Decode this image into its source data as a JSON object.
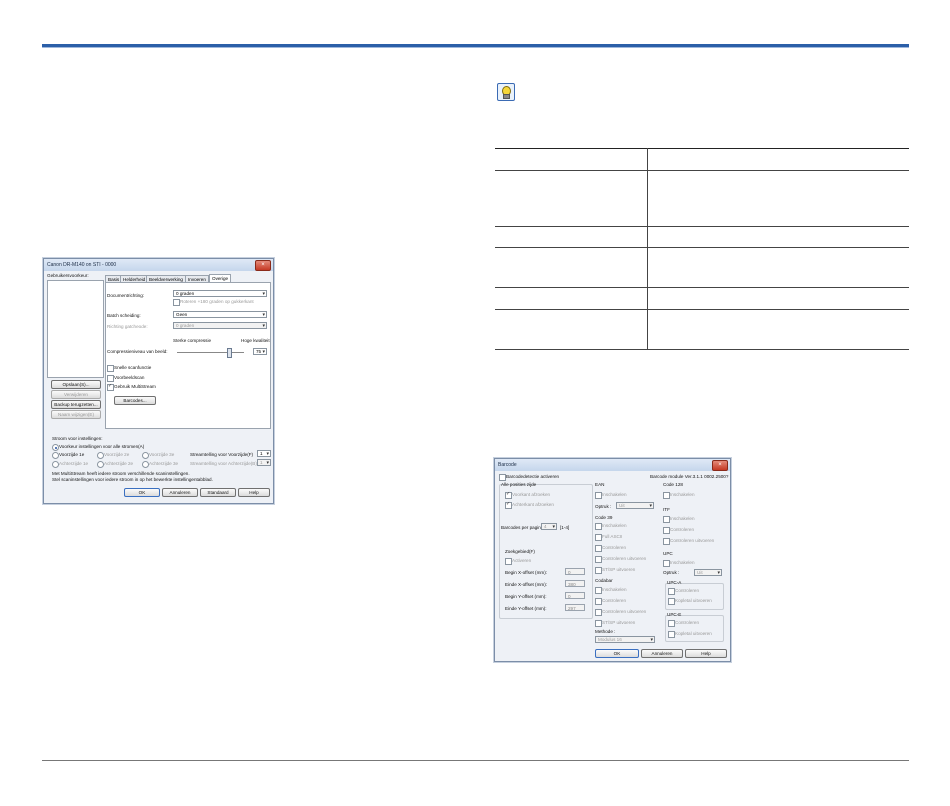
{
  "dialog1": {
    "title": "Canon DR-M140 on STI - 0000",
    "user_prefs_label": "Gebruikersvoorkeur:",
    "tabs": [
      "Basis",
      "Helderheid",
      "Beeldverwerking",
      "Invoeren",
      "Overige"
    ],
    "doc_orientation_label": "Documentrichting:",
    "doc_orientation_value": "0 graden",
    "rotate_cb": "Roteren +180 graden op gukkerkant",
    "batch_label": "Batch scheiding:",
    "batch_value": "Geen",
    "direction_label": "Richting gatcheode:",
    "direction_value": "0 graden",
    "compression_low": "Sterke compressie",
    "compression_high": "Hoge kwaliteit",
    "compression_label": "Compressieniveau van beeld:",
    "compression_value": "75",
    "fast_scan": "Snelle scanfunctie",
    "preview_scan": "Voorbeeldscan",
    "use_multistream": "Gebruik MultiStream",
    "barcode_btn": "Barcodes...",
    "left_buttons": [
      "Opslaan(S)...",
      "Verwijderen",
      "Backup terugzetten...",
      "Naam wijzigen(E)"
    ],
    "stream_settings_label": "Stroom voor instellingen:",
    "stream_all": "Voorkeur instellingen voor alle stromen(A)",
    "front1": "Voorzijde 1e",
    "front2": "Voorzijde 2e",
    "front3": "Voorzijde 3e",
    "back1": "Achterzijde 1e",
    "back2": "Achterzijde 2e",
    "back3": "Achterzijde 3e",
    "front_count_label": "Streamtelling voor Voorzijde(F)",
    "front_count_value": "1",
    "back_count_label": "Streamtelling voor Achterzijde(B)",
    "back_count_value": "1",
    "info_line1": "Met MultiStream heeft iedere stroom verschillende scaninstellingen.",
    "info_line2": "Stel scaninstellingen voor iedere stroom in op het bewerkte instellingentabblad.",
    "ok": "OK",
    "cancel": "Annuleren",
    "standard": "Standaard",
    "help": "Help"
  },
  "dialog2": {
    "title": "Barcode",
    "activate": "Barcodedetectie activeren",
    "module_version": "Barcode module Ver.3.1.1 0002.2500?",
    "all_positions": "Alle posities zijde",
    "front_only": "Voorkant afzoeken",
    "back_only": "Achterkant afzoeken",
    "per_page_label": "Barcodes per pagina :",
    "per_page_value": "4",
    "per_page_range": "[1-4]",
    "search_area": "Zoekgebied(F)",
    "search_activate": "Activeren",
    "begin_x": "Begin X-offset (mm):",
    "begin_x_value": "0",
    "end_x": "Einde X-offset (mm):",
    "end_x_value": "380",
    "begin_y": "Begin Y-offset (mm):",
    "begin_y_value": "0",
    "end_y": "Einde Y-offset (mm):",
    "end_y_value": "297",
    "ean": "EAN",
    "ean_enable": "Inschakelen",
    "ean_option_label": "Optruk :",
    "ean_option_value": "Uit",
    "code39": "Code 39",
    "code39_enable": "Inschakelen",
    "code39_fullascii": "Full ASCII",
    "code39_check": "Controleren",
    "code39_check_out": "Controleren uitvoeren",
    "code39_stsp": "ST/SP uitvoeren",
    "codabar": "Codabar",
    "codabar_enable": "Inschakelen",
    "codabar_check": "Controleren",
    "codabar_check_out": "Controleren uitvoeren",
    "codabar_stsp": "ST/SP uitvoeren",
    "method_label": "Methode :",
    "method_value": "Modulus 16",
    "code128": "Code 128",
    "code128_enable": "Inschakelen",
    "itf": "ITF",
    "itf_enable": "Inschakelen",
    "itf_check": "Controleren",
    "itf_check_out": "Controleren uitvoeren",
    "upc": "UPC",
    "upc_enable": "Inschakelen",
    "upc_option_label": "Optruk :",
    "upc_option_value": "Uit",
    "upca": "UPC-A",
    "upca_check": "Controleren",
    "upca_head": "Kopletal uitvoeren",
    "upce": "UPC-E",
    "upce_check": "Controleren",
    "upce_head": "Kopletal uitvoeren",
    "ok": "OK",
    "cancel": "Annuleren",
    "help": "Help"
  }
}
